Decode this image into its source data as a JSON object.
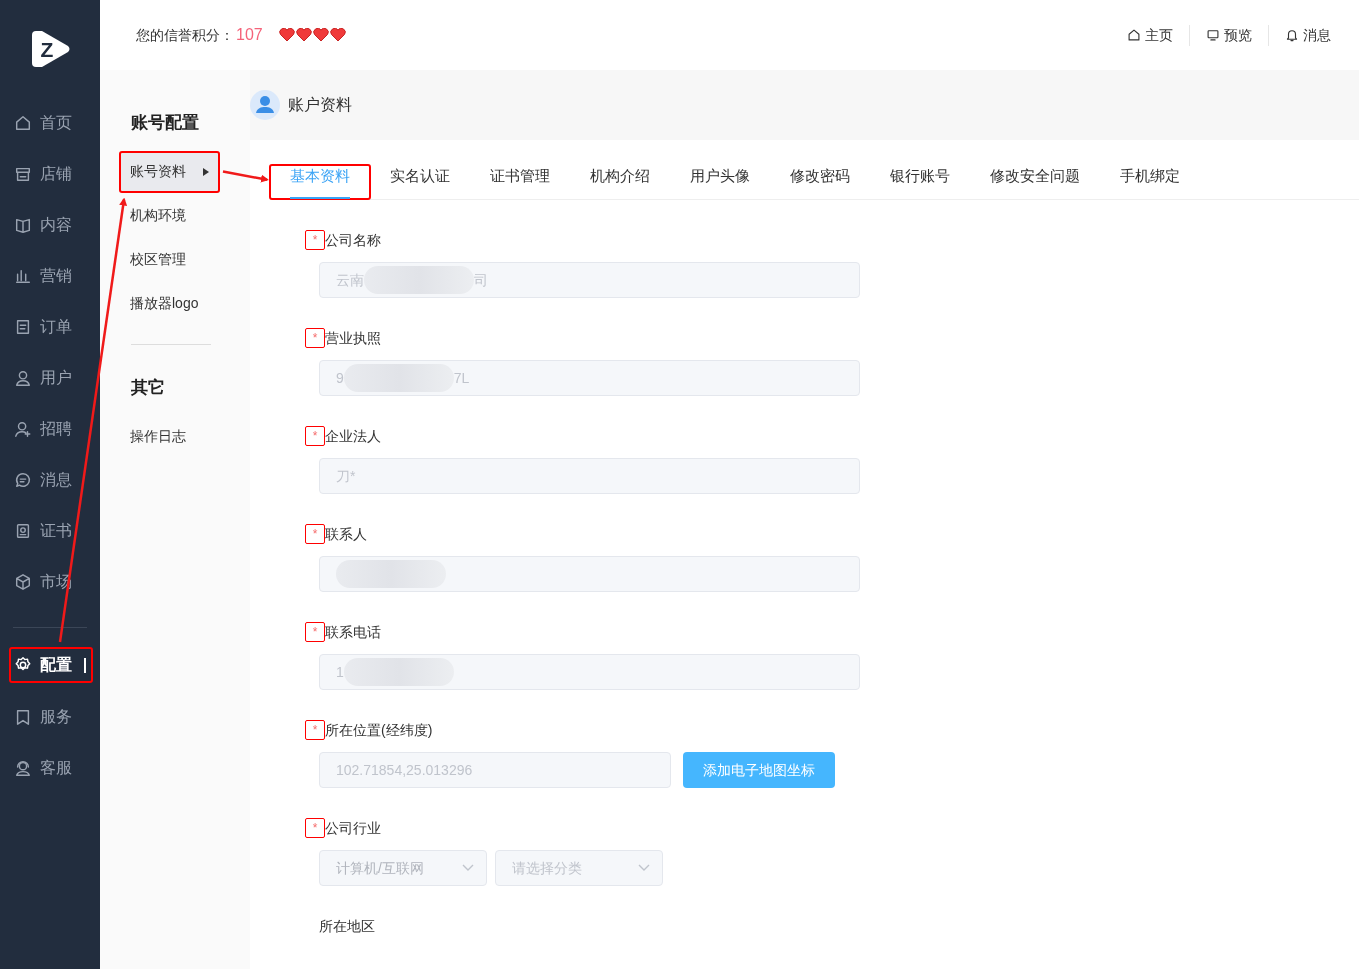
{
  "logo": {
    "letter": "Z"
  },
  "header": {
    "credit_label": "您的信誉积分：",
    "credit_value": "107",
    "stars": 4,
    "links": [
      {
        "label": "主页"
      },
      {
        "label": "预览"
      },
      {
        "label": "消息"
      }
    ]
  },
  "sidebar": {
    "items": [
      {
        "label": "首页",
        "selected": false
      },
      {
        "label": "店铺",
        "selected": false
      },
      {
        "label": "内容",
        "selected": false
      },
      {
        "label": "营销",
        "selected": false
      },
      {
        "label": "订单",
        "selected": false
      },
      {
        "label": "用户",
        "selected": false
      },
      {
        "label": "招聘",
        "selected": false
      },
      {
        "label": "消息",
        "selected": false
      },
      {
        "label": "证书",
        "selected": false
      },
      {
        "label": "市场",
        "selected": false
      },
      {
        "label": "配置",
        "selected": true
      },
      {
        "label": "服务",
        "selected": false
      },
      {
        "label": "客服",
        "selected": false
      }
    ]
  },
  "subnav": {
    "groups": [
      {
        "title": "账号配置",
        "items": [
          {
            "label": "账号资料",
            "selected": true
          },
          {
            "label": "机构环境",
            "selected": false
          },
          {
            "label": "校区管理",
            "selected": false
          },
          {
            "label": "播放器logo",
            "selected": false
          }
        ]
      },
      {
        "title": "其它",
        "items": [
          {
            "label": "操作日志",
            "selected": false
          }
        ]
      }
    ]
  },
  "page_title": "账户资料",
  "tabs": [
    {
      "label": "基本资料",
      "selected": true
    },
    {
      "label": "实名认证",
      "selected": false
    },
    {
      "label": "证书管理",
      "selected": false
    },
    {
      "label": "机构介绍",
      "selected": false
    },
    {
      "label": "用户头像",
      "selected": false
    },
    {
      "label": "修改密码",
      "selected": false
    },
    {
      "label": "银行账号",
      "selected": false
    },
    {
      "label": "修改安全问题",
      "selected": false
    },
    {
      "label": "手机绑定",
      "selected": false
    }
  ],
  "form": [
    {
      "kind": "text",
      "required_mark": "*",
      "label": "公司名称",
      "disabled": true,
      "redacted": true,
      "value_before": "云南",
      "value_after": "司"
    },
    {
      "kind": "text",
      "required_mark": "*",
      "label": "营业执照",
      "disabled": true,
      "redacted": true,
      "value_before": "9",
      "value_after": "7L"
    },
    {
      "kind": "text",
      "required_mark": "*",
      "label": "企业法人",
      "disabled": true,
      "redacted": false,
      "value_before": "刀*"
    },
    {
      "kind": "text",
      "required_mark": "*",
      "label": "联系人",
      "disabled": true,
      "redacted": true
    },
    {
      "kind": "text",
      "required_mark": "*",
      "label": "联系电话",
      "disabled": true,
      "redacted": true,
      "value_before": "1"
    },
    {
      "kind": "text-button",
      "required_mark": "*",
      "label": "所在位置(经纬度)",
      "disabled": true,
      "redacted": false,
      "value_before": "102.71854,25.013296",
      "button": "添加电子地图坐标"
    },
    {
      "kind": "selects",
      "required_mark": "*",
      "label": "公司行业",
      "options": [
        {
          "text": "计算机/互联网",
          "placeholder": false
        },
        {
          "text": "请选择分类",
          "placeholder": true
        }
      ]
    },
    {
      "kind": "label",
      "label": "所在地区"
    }
  ],
  "annotated": true
}
